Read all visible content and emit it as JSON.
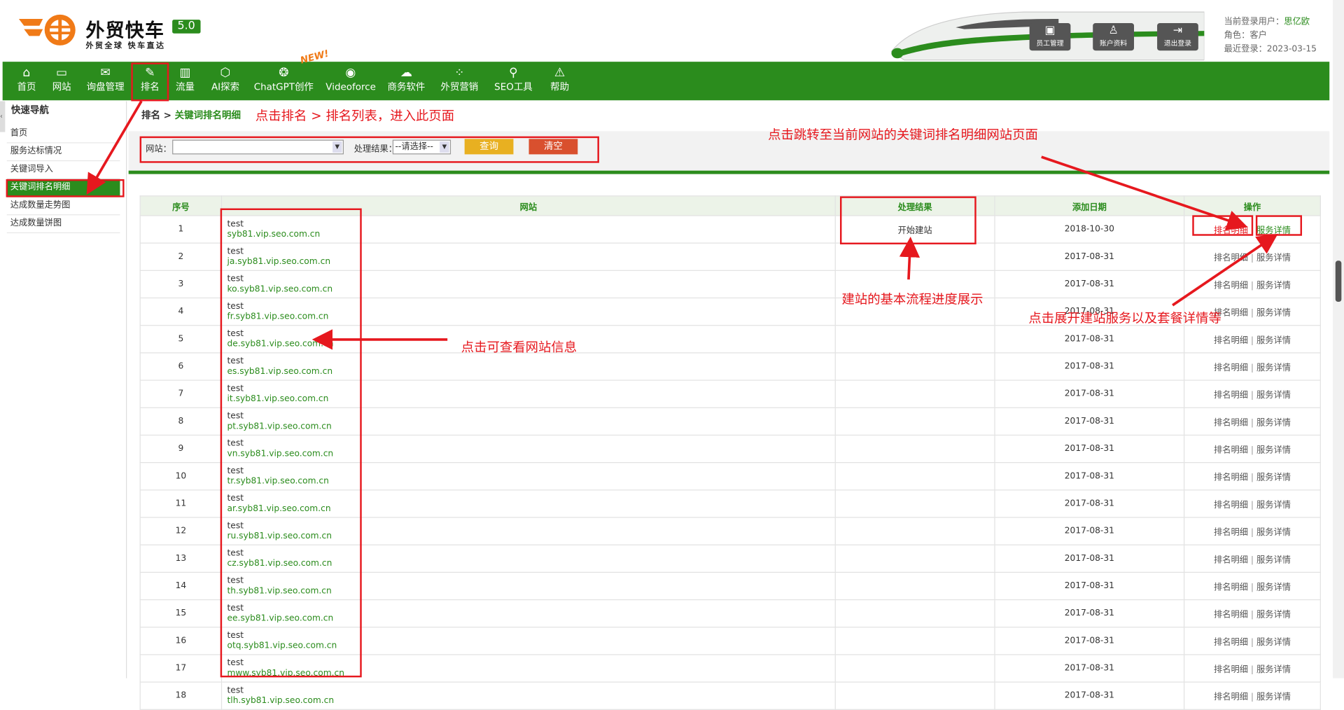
{
  "header": {
    "brand": "外贸快车",
    "version": "5.0",
    "slogan": "外贸全球 快车直达",
    "buttons": [
      {
        "label": "员工管理",
        "icon": "staff-icon"
      },
      {
        "label": "账户资料",
        "icon": "user-icon"
      },
      {
        "label": "退出登录",
        "icon": "logout-icon"
      }
    ],
    "user_label": "当前登录用户：",
    "user_value": "思亿欧",
    "role_label": "角色：",
    "role_value": "客户",
    "last_label": "最近登录：",
    "last_value": "2023-03-15"
  },
  "nav": {
    "items": [
      {
        "label": "首页",
        "icon": "home-icon",
        "glyph": "⌂"
      },
      {
        "label": "网站",
        "icon": "monitor-icon",
        "glyph": "▭"
      },
      {
        "label": "询盘管理",
        "icon": "mail-icon",
        "glyph": "✉"
      },
      {
        "label": "排名",
        "icon": "pen-icon",
        "glyph": "✎"
      },
      {
        "label": "流量",
        "icon": "chart-icon",
        "glyph": "▥"
      },
      {
        "label": "AI探索",
        "icon": "ai-icon",
        "glyph": "⬡"
      },
      {
        "label": "ChatGPT创作",
        "icon": "chatgpt-icon",
        "glyph": "❂"
      },
      {
        "label": "Videoforce",
        "icon": "video-icon",
        "glyph": "◉"
      },
      {
        "label": "商务软件",
        "icon": "cloud-icon",
        "glyph": "☁"
      },
      {
        "label": "外贸营销",
        "icon": "grid-icon",
        "glyph": "⁘"
      },
      {
        "label": "SEO工具",
        "icon": "search-icon",
        "glyph": "⚲"
      },
      {
        "label": "帮助",
        "icon": "warning-icon",
        "glyph": "⚠"
      }
    ],
    "new_badge": "NEW!"
  },
  "sidebar": {
    "title": "快速导航",
    "items": [
      {
        "label": "首页"
      },
      {
        "label": "服务达标情况"
      },
      {
        "label": "关键词导入"
      },
      {
        "label": "关键词排名明细"
      },
      {
        "label": "达成数量走势图"
      },
      {
        "label": "达成数量饼图"
      }
    ]
  },
  "breadcrumb": {
    "root": "排名 > ",
    "current": "关键词排名明细"
  },
  "filter": {
    "site_label": "网站：",
    "site_value": "",
    "result_label": "处理结果：",
    "result_value": "--请选择--",
    "query": "查询",
    "clear": "清空"
  },
  "table": {
    "headers": [
      "序号",
      "网站",
      "处理结果",
      "添加日期",
      "操作"
    ],
    "op_rank": "排名明细",
    "op_sep": "|",
    "op_service": "服务详情",
    "rows": [
      {
        "no": "1",
        "name": "test",
        "domain": "syb81.vip.seo.com.cn",
        "result": "开始建站",
        "date": "2018-10-30"
      },
      {
        "no": "2",
        "name": "test",
        "domain": "ja.syb81.vip.seo.com.cn",
        "result": "",
        "date": "2017-08-31"
      },
      {
        "no": "3",
        "name": "test",
        "domain": "ko.syb81.vip.seo.com.cn",
        "result": "",
        "date": "2017-08-31"
      },
      {
        "no": "4",
        "name": "test",
        "domain": "fr.syb81.vip.seo.com.cn",
        "result": "",
        "date": "2017-08-31"
      },
      {
        "no": "5",
        "name": "test",
        "domain": "de.syb81.vip.seo.com.cn",
        "result": "",
        "date": "2017-08-31"
      },
      {
        "no": "6",
        "name": "test",
        "domain": "es.syb81.vip.seo.com.cn",
        "result": "",
        "date": "2017-08-31"
      },
      {
        "no": "7",
        "name": "test",
        "domain": "it.syb81.vip.seo.com.cn",
        "result": "",
        "date": "2017-08-31"
      },
      {
        "no": "8",
        "name": "test",
        "domain": "pt.syb81.vip.seo.com.cn",
        "result": "",
        "date": "2017-08-31"
      },
      {
        "no": "9",
        "name": "test",
        "domain": "vn.syb81.vip.seo.com.cn",
        "result": "",
        "date": "2017-08-31"
      },
      {
        "no": "10",
        "name": "test",
        "domain": "tr.syb81.vip.seo.com.cn",
        "result": "",
        "date": "2017-08-31"
      },
      {
        "no": "11",
        "name": "test",
        "domain": "ar.syb81.vip.seo.com.cn",
        "result": "",
        "date": "2017-08-31"
      },
      {
        "no": "12",
        "name": "test",
        "domain": "ru.syb81.vip.seo.com.cn",
        "result": "",
        "date": "2017-08-31"
      },
      {
        "no": "13",
        "name": "test",
        "domain": "cz.syb81.vip.seo.com.cn",
        "result": "",
        "date": "2017-08-31"
      },
      {
        "no": "14",
        "name": "test",
        "domain": "th.syb81.vip.seo.com.cn",
        "result": "",
        "date": "2017-08-31"
      },
      {
        "no": "15",
        "name": "test",
        "domain": "ee.syb81.vip.seo.com.cn",
        "result": "",
        "date": "2017-08-31"
      },
      {
        "no": "16",
        "name": "test",
        "domain": "otq.syb81.vip.seo.com.cn",
        "result": "",
        "date": "2017-08-31"
      },
      {
        "no": "17",
        "name": "test",
        "domain": "mww.syb81.vip.seo.com.cn",
        "result": "",
        "date": "2017-08-31"
      },
      {
        "no": "18",
        "name": "test",
        "domain": "tlh.syb81.vip.seo.com.cn",
        "result": "",
        "date": "2017-08-31"
      }
    ]
  },
  "annotations": {
    "a1": "点击排名 > 排名列表，进入此页面",
    "a2": "点击跳转至当前网站的关键词排名明细网站页面",
    "a3": "建站的基本流程进度展示",
    "a4": "点击展开建站服务以及套餐详情等",
    "a5": "点击可查看网站信息"
  },
  "colors": {
    "brand_green": "#2b8c1d",
    "annotation_red": "#e6181e",
    "query_yellow": "#e8b021",
    "clear_red": "#d9502e"
  }
}
